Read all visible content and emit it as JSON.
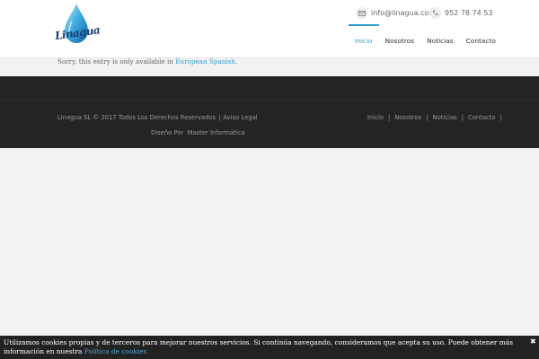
{
  "header": {
    "logo_text": "Linagua",
    "email": "info@linagua.com",
    "phone": "952 78 74 53",
    "nav": [
      "Inicio",
      "Nosotros",
      "Noticias",
      "Contacto"
    ],
    "active_nav": "Inicio"
  },
  "notice": {
    "prefix": "Sorry, this entry is only available in",
    "link": "European Spanish",
    "suffix": "."
  },
  "footer": {
    "copyright": "Linagua SL © 2017 Todos Los Derechos Reservados",
    "separator": "|",
    "legal_link": "Aviso Legal",
    "design_label": "Diseño Por",
    "designer": "Master Informática",
    "nav": [
      "Inicio",
      "Nosotros",
      "Noticias",
      "Contacto"
    ]
  },
  "cookie": {
    "text": "Utilizamos cookies propias y de terceros para mejorar nuestros servicios. Si continúa navegando, consideramos que acepta su uso. Puede obtener más información en nuestra",
    "link": "Política de cookies",
    "close": "✖"
  },
  "colors": {
    "accent": "#2e9cc9",
    "footer_bg": "#242424",
    "page_bg": "#f2f2f2"
  }
}
